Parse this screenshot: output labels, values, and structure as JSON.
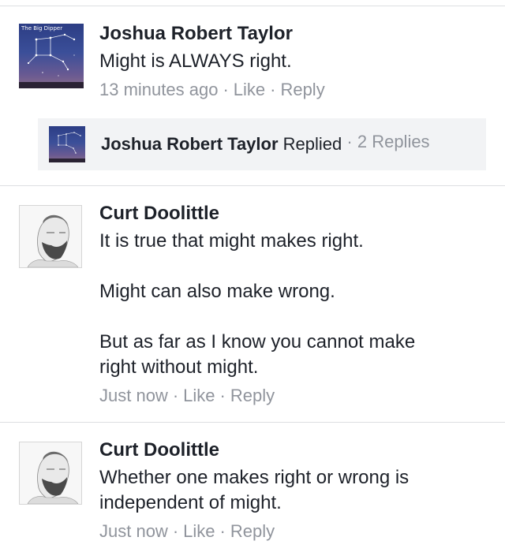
{
  "comments": [
    {
      "author": "Joshua Robert Taylor",
      "lines": [
        "Might is ALWAYS right."
      ],
      "time": "13 minutes ago",
      "like": "Like",
      "reply": "Reply",
      "avatar_caption": "The Big Dipper",
      "avatar_icon": "big-dipper-constellation-avatar"
    },
    {
      "author": "Curt Doolittle",
      "lines": [
        "It is true that might makes right.",
        "Might can also make wrong.",
        "But as far as I know you cannot make",
        "right without might."
      ],
      "time": "Just now",
      "like": "Like",
      "reply": "Reply",
      "avatar_icon": "sketch-portrait-avatar"
    },
    {
      "author": "Curt Doolittle",
      "lines": [
        "Whether one makes right or wrong is",
        "independent of might."
      ],
      "time": "Just now",
      "like": "Like",
      "reply": "Reply",
      "avatar_icon": "sketch-portrait-avatar"
    }
  ],
  "reply_summary": {
    "author": "Joshua Robert Taylor",
    "action": "Replied",
    "count_text": "2 Replies"
  },
  "separator": "·",
  "colors": {
    "text": "#1d2129",
    "meta": "#90949c",
    "divider": "#dddfe2",
    "reply_bg": "#f2f3f5"
  }
}
